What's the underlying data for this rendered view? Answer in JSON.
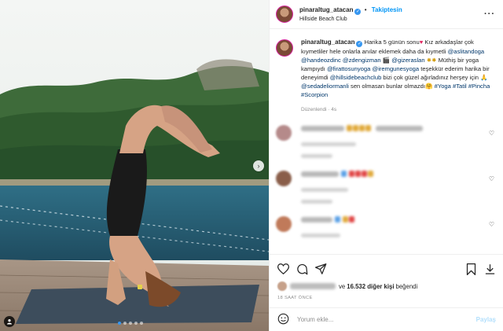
{
  "header": {
    "username": "pinaraltug_atacan",
    "follow_label": "Takiptesin",
    "location": "Hillside Beach Club",
    "separator": "•"
  },
  "caption": {
    "username": "pinaraltug_atacan",
    "text_1": "Harika 5 günün sonu",
    "text_2": " Kız arkadaşlar çok kıymetliler hele onlarla anılar eklemek daha da kıymetli",
    "mention_1": "@aslitandoga",
    "mention_2": "@handeozdinc",
    "mention_3": "@zdengizman",
    "mention_4": "@gizeraslan",
    "text_3": "Müthiş bir yoga kampıydı",
    "mention_5": "@firattosunyoga",
    "mention_6": "@iremgunesyoga",
    "text_4": "teşekkür ederim harika bir deneyimdi",
    "mention_7": "@hillsidebeachclub",
    "text_5": "bizi çok güzel ağırladınız herşey için",
    "mention_8": "@sedadeliormanli",
    "text_6": "sen olmasan bunlar olmazdı",
    "hashtag_1": "#Yoga",
    "hashtag_2": "#Tatil",
    "hashtag_3": "#Pincha",
    "hashtag_4": "#Scorpion",
    "edited": "Düzenlendi · 4s"
  },
  "likes": {
    "text_mid": " ve ",
    "count": "16.532 diğer kişi",
    "text_end": " beğendi"
  },
  "timestamp": "18 SAAT ÖNCE",
  "add_comment": {
    "placeholder": "Yorum ekle...",
    "post_label": "Paylaş"
  },
  "colors": {
    "link": "#00376b",
    "accent": "#0095f6",
    "heart": "#e0245e"
  },
  "icons": [
    "heart-icon",
    "comment-icon",
    "share-icon",
    "bookmark-icon",
    "download-icon",
    "emoji-icon",
    "more-options-icon",
    "next-arrow-icon",
    "user-tag-icon"
  ]
}
